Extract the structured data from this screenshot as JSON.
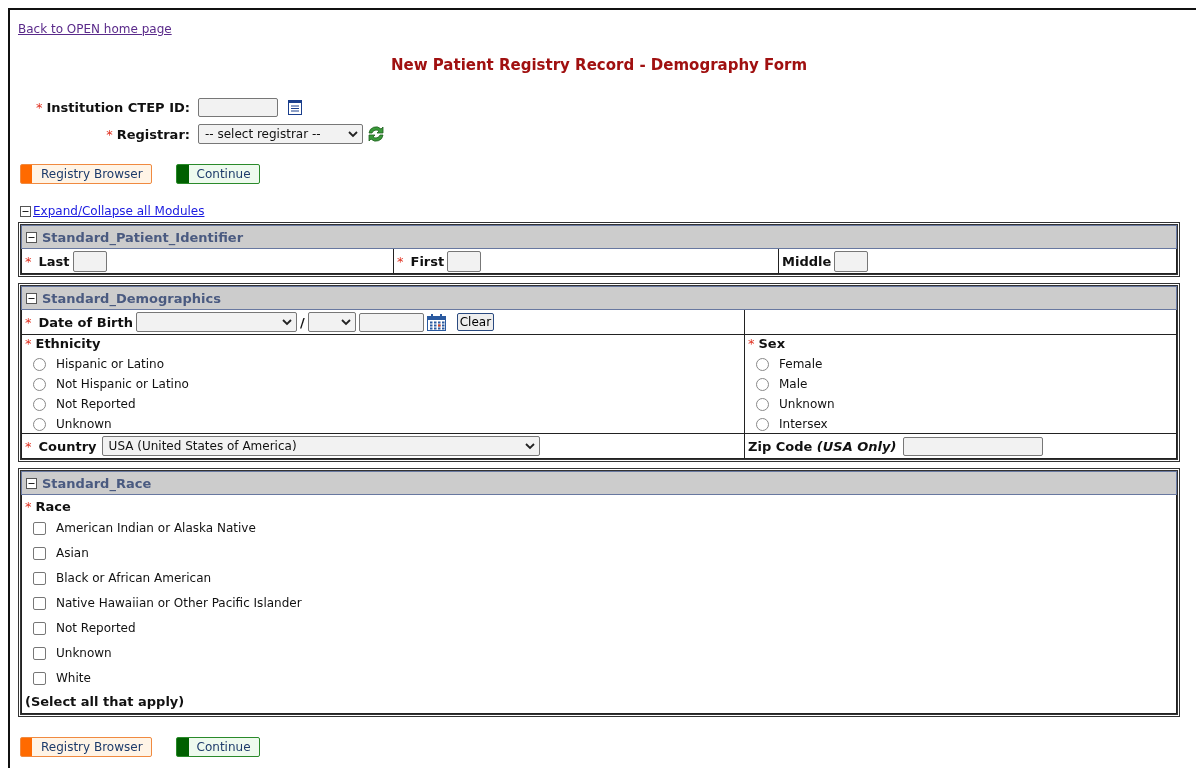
{
  "back_link": "Back to OPEN home page",
  "title": "New Patient Registry Record - Demography Form",
  "header_fields": [
    {
      "label": "Institution CTEP ID:",
      "required_mark": "*",
      "kind": "text"
    },
    {
      "label": "Registrar:",
      "required_mark": "*",
      "kind": "select",
      "value": "-- select registrar --"
    }
  ],
  "buttons_top": [
    {
      "label": "Registry Browser",
      "kind": "browse"
    },
    {
      "label": "Continue",
      "kind": "continue"
    }
  ],
  "expand_link": "Expand/Collapse all Modules",
  "identifier_module": {
    "title": "Standard_Patient_Identifier",
    "expanded": true,
    "fields": [
      {
        "label": "Last",
        "required_mark": "*"
      },
      {
        "label": "First",
        "required_mark": "*"
      },
      {
        "label": "Middle"
      }
    ]
  },
  "demographics_module": {
    "title": "Standard_Demographics",
    "expanded": true,
    "date_of_birth": {
      "label": "Date of Birth",
      "required_mark": "*",
      "separator": "/",
      "clear_button": "Clear"
    },
    "ethnicity": {
      "label": "Ethnicity",
      "required_mark": "*",
      "options": [
        {
          "label": "Hispanic or Latino",
          "selected": false
        },
        {
          "label": "Not Hispanic or Latino",
          "selected": false
        },
        {
          "label": "Not Reported",
          "selected": false
        },
        {
          "label": "Unknown",
          "selected": false
        }
      ]
    },
    "sex": {
      "label": "Sex",
      "required_mark": "*",
      "options": [
        {
          "label": "Female",
          "selected": false
        },
        {
          "label": "Male",
          "selected": false
        },
        {
          "label": "Unknown",
          "selected": false
        },
        {
          "label": "Intersex",
          "selected": false
        }
      ]
    },
    "country": {
      "label": "Country",
      "required_mark": "*",
      "value": "USA (United States of America)"
    },
    "zip_code": {
      "label": "Zip Code  *(USA Only)*"
    }
  },
  "race_module": {
    "title": "Standard_Race",
    "expanded": true,
    "label": "Race",
    "required_mark": "*",
    "options": [
      {
        "label": "American Indian or Alaska Native",
        "checked": false
      },
      {
        "label": "Asian",
        "checked": false
      },
      {
        "label": "Black or African American",
        "checked": false
      },
      {
        "label": "Native Hawaiian or Other Pacific Islander",
        "checked": false
      },
      {
        "label": "Not Reported",
        "checked": false
      },
      {
        "label": "Unknown",
        "checked": false
      },
      {
        "label": "White",
        "checked": false
      }
    ],
    "note": "(Select all that apply)"
  },
  "buttons_bottom": [
    {
      "label": "Registry Browser",
      "kind": "browse"
    },
    {
      "label": "Continue",
      "kind": "continue"
    }
  ]
}
